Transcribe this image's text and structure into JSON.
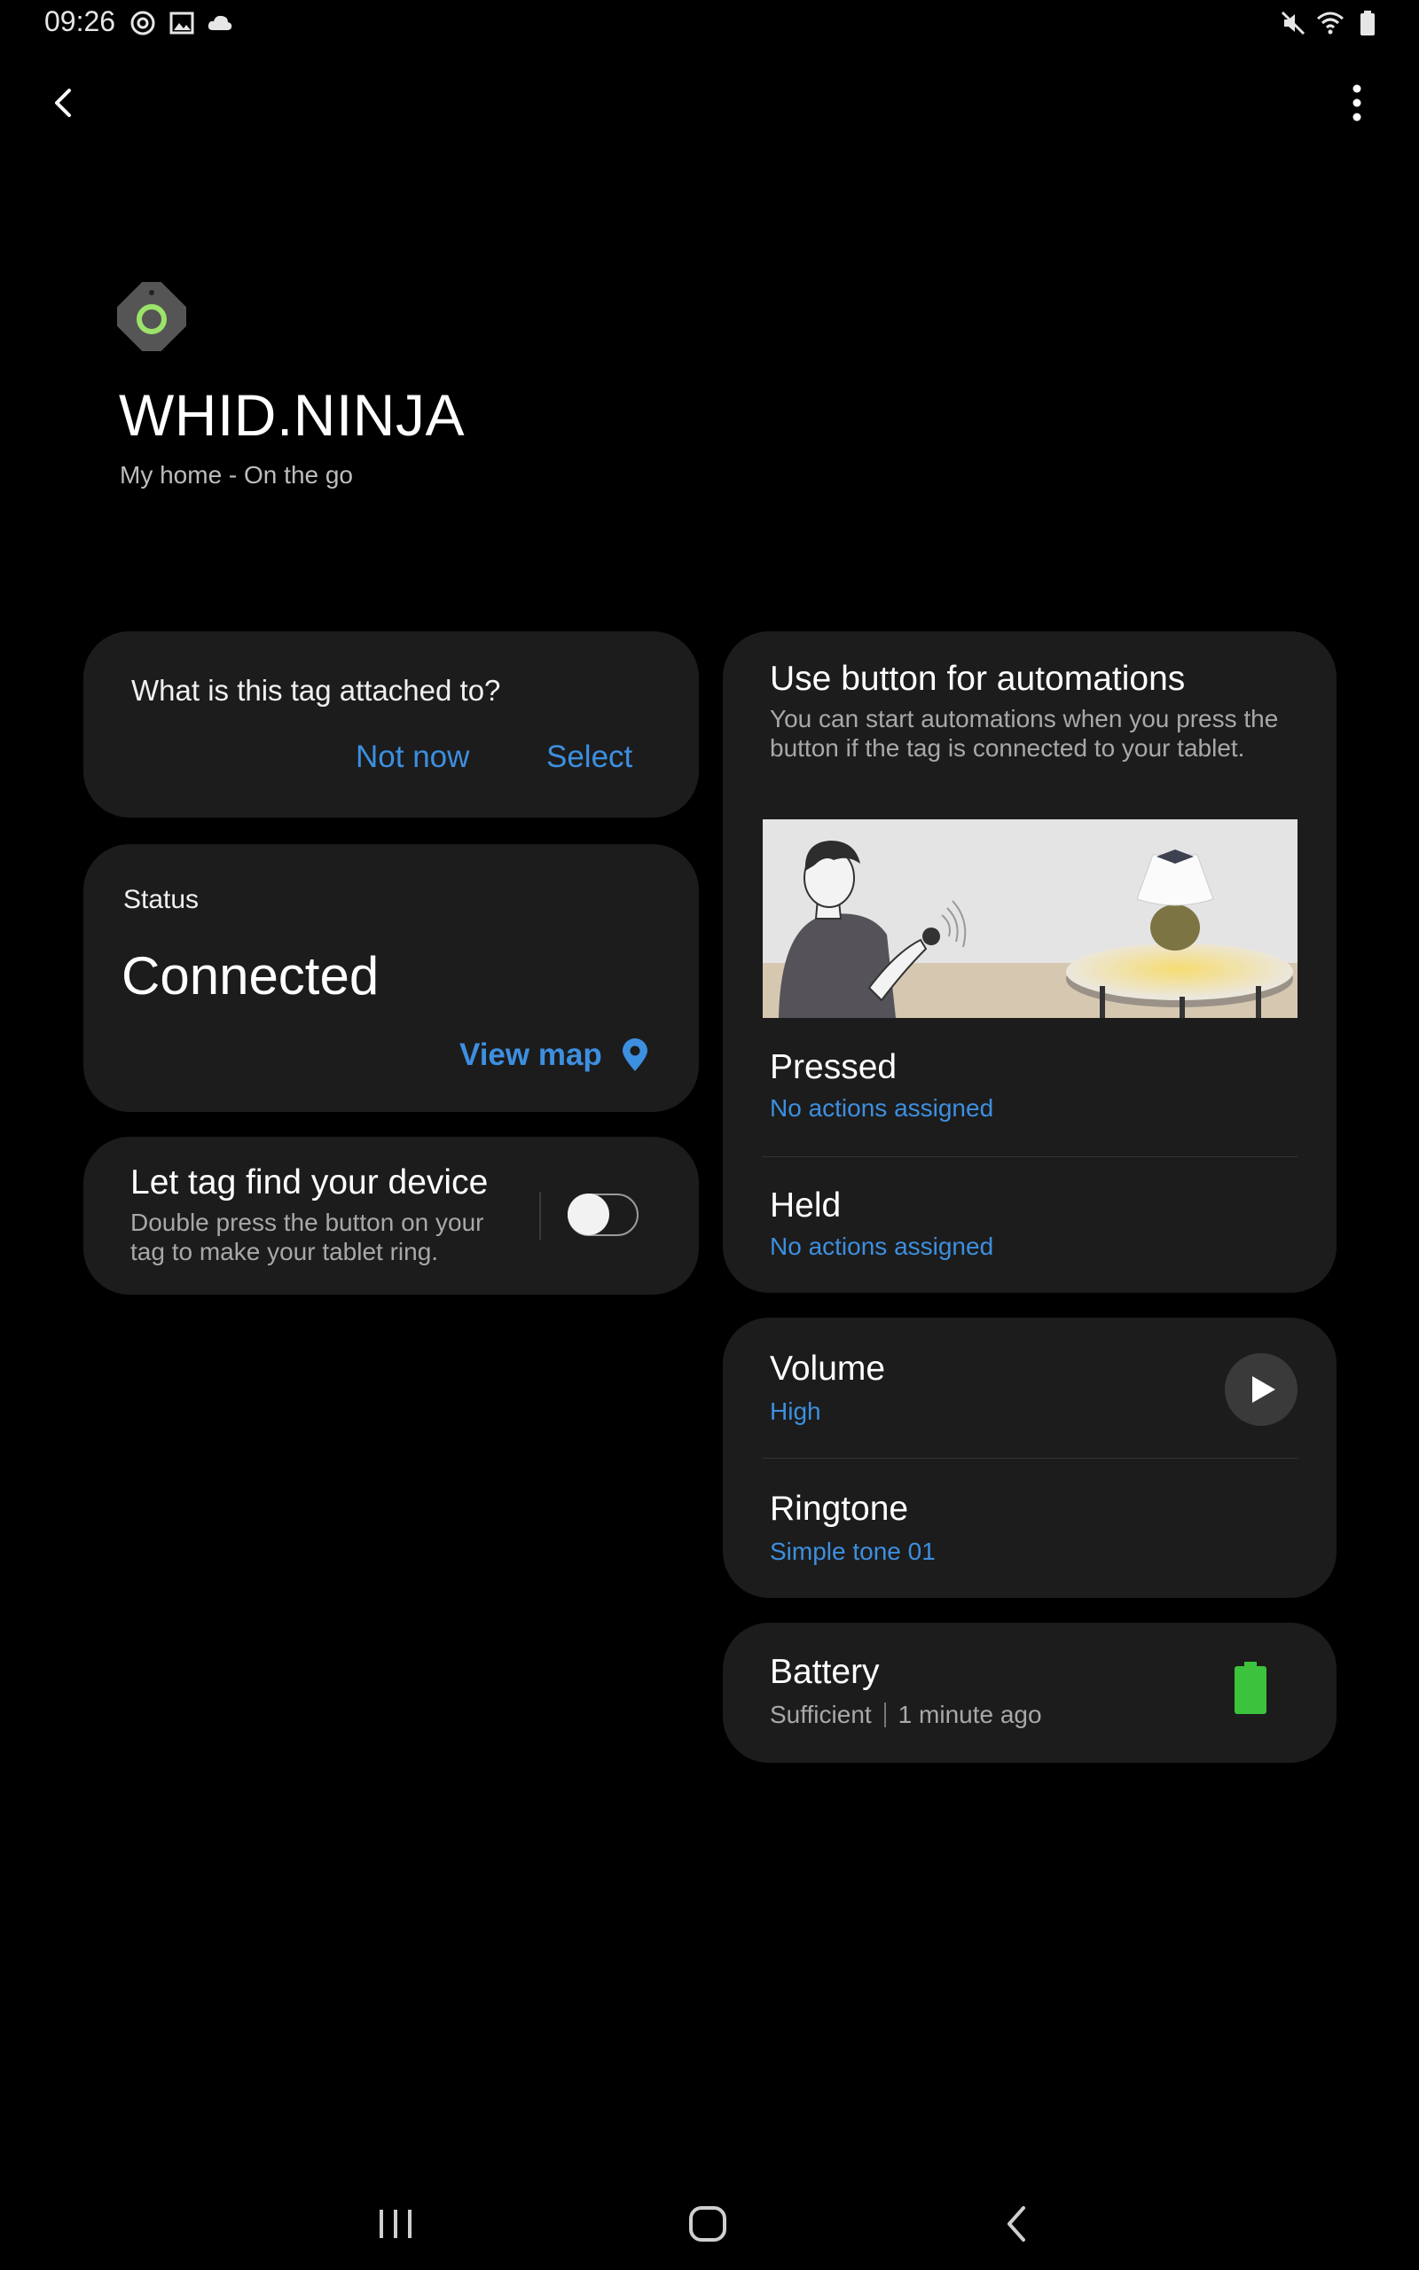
{
  "status_bar": {
    "time": "09:26"
  },
  "device": {
    "name": "WHID.NINJA",
    "location": "My home - On the go"
  },
  "attach_card": {
    "question": "What is this tag attached to?",
    "not_now": "Not now",
    "select": "Select"
  },
  "status_card": {
    "label": "Status",
    "value": "Connected",
    "view_map": "View map"
  },
  "find_card": {
    "title": "Let tag find your device",
    "description": "Double press the button on your tag to make your tablet ring.",
    "toggle_on": false
  },
  "automation_card": {
    "title": "Use button for automations",
    "description": "You can start automations when you press the button if the tag is connected to your tablet.",
    "pressed_label": "Pressed",
    "pressed_value": "No actions assigned",
    "held_label": "Held",
    "held_value": "No actions assigned"
  },
  "sound_card": {
    "volume_label": "Volume",
    "volume_value": "High",
    "ringtone_label": "Ringtone",
    "ringtone_value": "Simple tone 01"
  },
  "battery_card": {
    "label": "Battery",
    "level": "Sufficient",
    "updated": "1 minute ago"
  },
  "colors": {
    "accent": "#3d8fe0",
    "card": "#1c1c1c",
    "battery": "#3cc23c",
    "tag_ring": "#9be36a"
  },
  "icons": [
    "mute-icon",
    "wifi-icon",
    "battery-status-icon",
    "back-icon",
    "more-options-icon",
    "location-pin-icon",
    "play-icon",
    "battery-icon",
    "recent-apps-icon",
    "home-icon",
    "nav-back-icon"
  ]
}
